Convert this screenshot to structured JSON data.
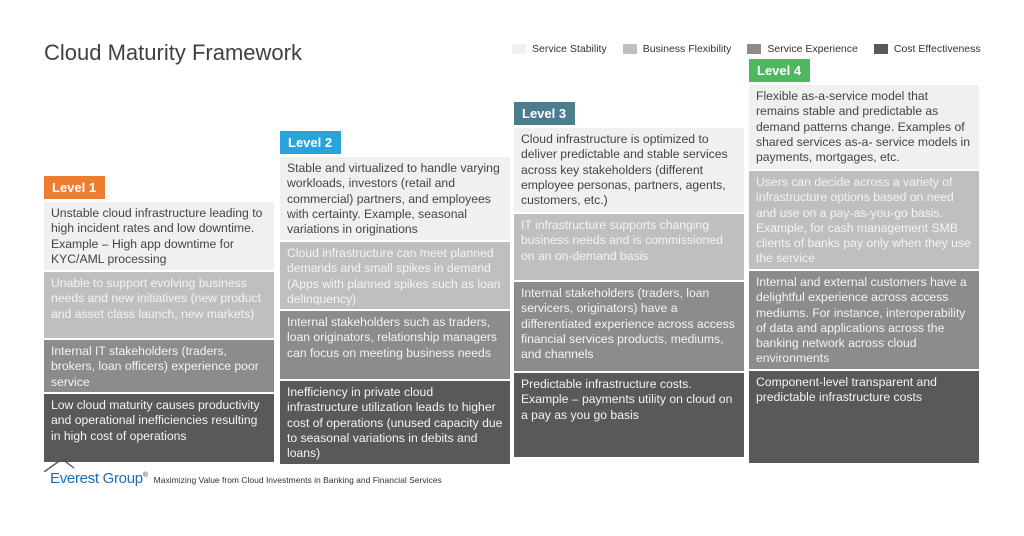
{
  "title": "Cloud Maturity Framework",
  "legend": [
    {
      "label": "Service Stability",
      "color": "#f0f0f0"
    },
    {
      "label": "Business Flexibility",
      "color": "#bfbfbf"
    },
    {
      "label": "Service Experience",
      "color": "#8c8c8c"
    },
    {
      "label": "Cost Effectiveness",
      "color": "#595959"
    }
  ],
  "levels": [
    {
      "label": "Level 1",
      "color": "#ed7d31",
      "cells": [
        "Unstable cloud infrastructure leading to high incident rates and low downtime. Example – High app downtime for KYC/AML processing",
        "Unable to support evolving business needs and new initiatives (new product and asset class launch, new markets)",
        "Internal IT stakeholders (traders, brokers, loan officers) experience poor service",
        "Low cloud maturity causes productivity and operational inefficiencies resulting in high cost of operations"
      ]
    },
    {
      "label": "Level 2",
      "color": "#29a3dc",
      "cells": [
        "Stable and virtualized to handle varying workloads, investors (retail and commercial) partners, and employees with certainty. Example, seasonal variations in originations",
        "Cloud infrastructure can meet planned demands and small spikes in demand (Apps with planned spikes such as loan delinquency)",
        "Internal stakeholders such as traders, loan originators, relationship managers can focus on meeting business needs",
        "Inefficiency in private cloud infrastructure utilization leads to higher cost of operations (unused capacity due to seasonal variations in debits and loans)"
      ]
    },
    {
      "label": "Level 3",
      "color": "#4a7e8f",
      "cells": [
        "Cloud infrastructure is optimized to deliver predictable and stable services across key stakeholders (different employee personas, partners, agents, customers, etc.)",
        "IT infrastructure supports changing business needs and is commissioned on an on-demand basis",
        "Internal stakeholders (traders, loan servicers, originators) have a differentiated experience across access financial services products, mediums, and channels",
        "Predictable infrastructure costs. Example – payments utility on cloud on a pay as you go basis"
      ]
    },
    {
      "label": "Level 4",
      "color": "#4cb860",
      "cells": [
        "Flexible as-a-service model that remains stable and predictable as demand patterns change. Examples of shared services as-a- service models in payments, mortgages, etc.",
        "Users can decide across a variety of infrastructure options based on need and use on a pay-as-you-go basis. Example, for cash management SMB clients of banks pay only when they use the service",
        "Internal and external customers have a delightful experience across access mediums. For instance, interoperability of data and applications across the banking network across cloud environments",
        "Component-level transparent and predictable infrastructure costs"
      ]
    }
  ],
  "footer": {
    "brand": "Everest Group",
    "registered": "®",
    "caption": "Maximizing Value from Cloud Investments in Banking and Financial Services"
  }
}
